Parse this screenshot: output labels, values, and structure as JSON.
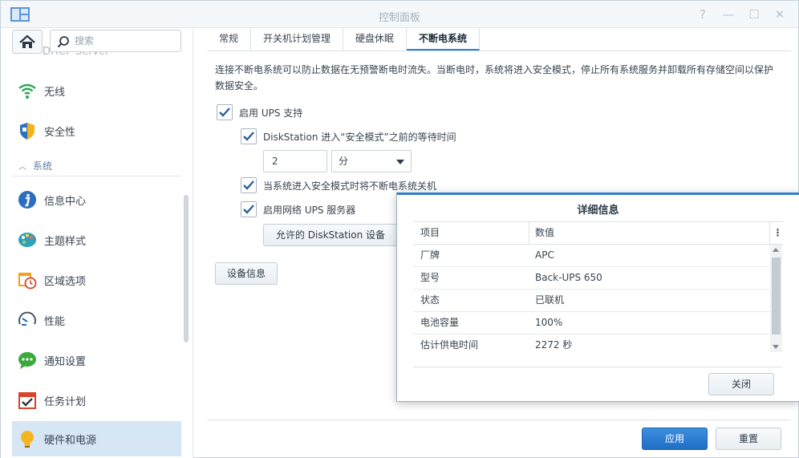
{
  "window": {
    "title": "控制面板"
  },
  "sidebar": {
    "search_placeholder": "搜索",
    "partial_item": "DHCP Server",
    "section_label": "系统",
    "items": [
      {
        "label": "无线",
        "icon": "wifi-icon"
      },
      {
        "label": "安全性",
        "icon": "shield-icon"
      },
      {
        "label": "信息中心",
        "icon": "info-icon"
      },
      {
        "label": "主题样式",
        "icon": "palette-icon"
      },
      {
        "label": "区域选项",
        "icon": "calendar-clock-icon"
      },
      {
        "label": "性能",
        "icon": "gauge-icon"
      },
      {
        "label": "通知设置",
        "icon": "chat-bubble-icon"
      },
      {
        "label": "任务计划",
        "icon": "task-calendar-icon"
      },
      {
        "label": "硬件和电源",
        "icon": "lightbulb-icon"
      }
    ]
  },
  "tabs": [
    {
      "label": "常规"
    },
    {
      "label": "开关机计划管理"
    },
    {
      "label": "硬盘休眠"
    },
    {
      "label": "不断电系统"
    }
  ],
  "main": {
    "description": "连接不断电系统可以防止数据在无预警断电时流失。当断电时，系统将进入安全模式，停止所有系统服务并卸载所有存储空间以保护数据安全。",
    "enable_ups": "启用 UPS 支持",
    "wait_time_label": "DiskStation 进入“安全模式”之前的等待时间",
    "wait_time_value": "2",
    "wait_time_unit": "分",
    "shutdown_ups": "当系统进入安全模式时将不断电系统关机",
    "network_ups": "启用网络 UPS 服务器",
    "allowed_devices_button": "允许的 DiskStation 设备",
    "device_info_button": "设备信息",
    "apply_button": "应用",
    "reset_button": "重置"
  },
  "dialog": {
    "title": "详细信息",
    "columns": [
      "项目",
      "数值"
    ],
    "menu_glyph": "⋮",
    "rows": [
      {
        "item": "厂牌",
        "value": "APC"
      },
      {
        "item": "型号",
        "value": "Back-UPS 650"
      },
      {
        "item": "状态",
        "value": "已联机"
      },
      {
        "item": "电池容量",
        "value": "100%"
      },
      {
        "item": "估计供电时间",
        "value": "2272 秒"
      }
    ],
    "close_button": "关闭"
  },
  "colors": {
    "accent": "#2f7fd0",
    "active_sidebar": "#d7e6f5",
    "primary_button": "#1f6fc6"
  }
}
